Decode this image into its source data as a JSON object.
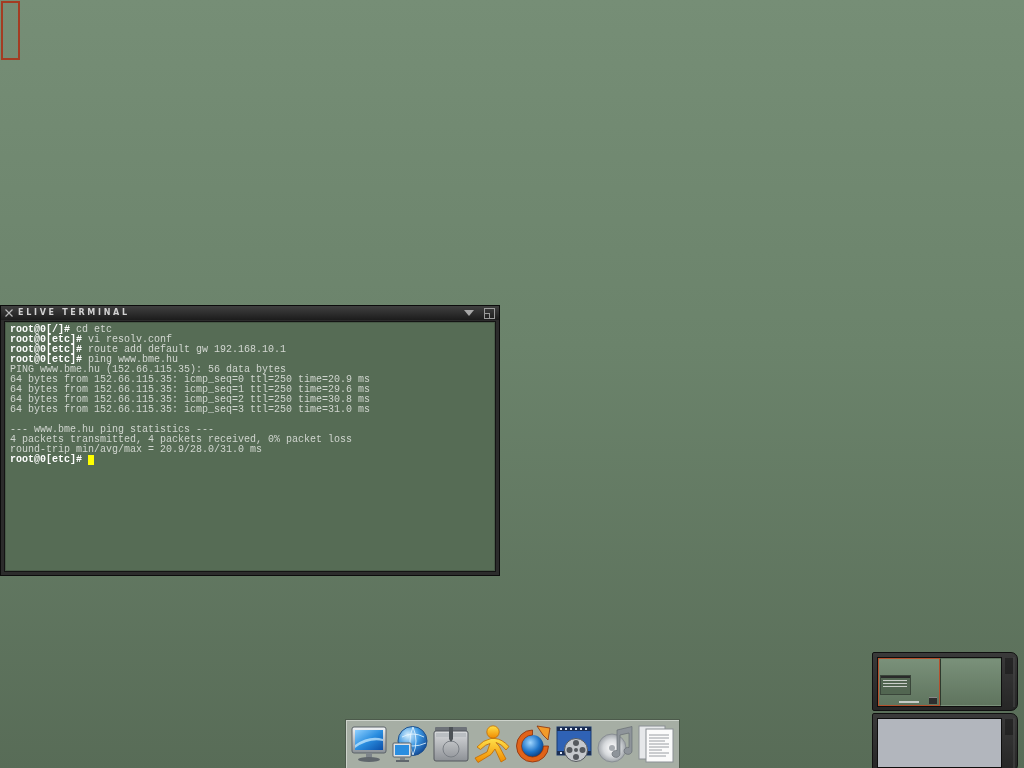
{
  "terminal": {
    "title": "ELIVE TERMINAL",
    "lines": [
      {
        "kind": "prompt",
        "prompt": "root@0[/]#",
        "command": "cd etc"
      },
      {
        "kind": "prompt",
        "prompt": "root@0[etc]#",
        "command": "vi resolv.conf"
      },
      {
        "kind": "prompt",
        "prompt": "root@0[etc]#",
        "command": "route add default gw 192.168.10.1"
      },
      {
        "kind": "prompt",
        "prompt": "root@0[etc]#",
        "command": "ping www.bme.hu"
      },
      {
        "kind": "output",
        "text": "PING www.bme.hu (152.66.115.35): 56 data bytes"
      },
      {
        "kind": "output",
        "text": "64 bytes from 152.66.115.35: icmp_seq=0 ttl=250 time=20.9 ms"
      },
      {
        "kind": "output",
        "text": "64 bytes from 152.66.115.35: icmp_seq=1 ttl=250 time=29.6 ms"
      },
      {
        "kind": "output",
        "text": "64 bytes from 152.66.115.35: icmp_seq=2 ttl=250 time=30.8 ms"
      },
      {
        "kind": "output",
        "text": "64 bytes from 152.66.115.35: icmp_seq=3 ttl=250 time=31.0 ms"
      },
      {
        "kind": "blank"
      },
      {
        "kind": "output",
        "text": "--- www.bme.hu ping statistics ---"
      },
      {
        "kind": "output",
        "text": "4 packets transmitted, 4 packets received, 0% packet loss"
      },
      {
        "kind": "output",
        "text": "round-trip min/avg/max = 20.9/28.0/31.0 ms"
      },
      {
        "kind": "active_prompt",
        "prompt": "root@0[etc]#"
      }
    ]
  },
  "pager": {
    "desks": [
      {
        "selected": true
      },
      {
        "selected": false
      }
    ]
  }
}
